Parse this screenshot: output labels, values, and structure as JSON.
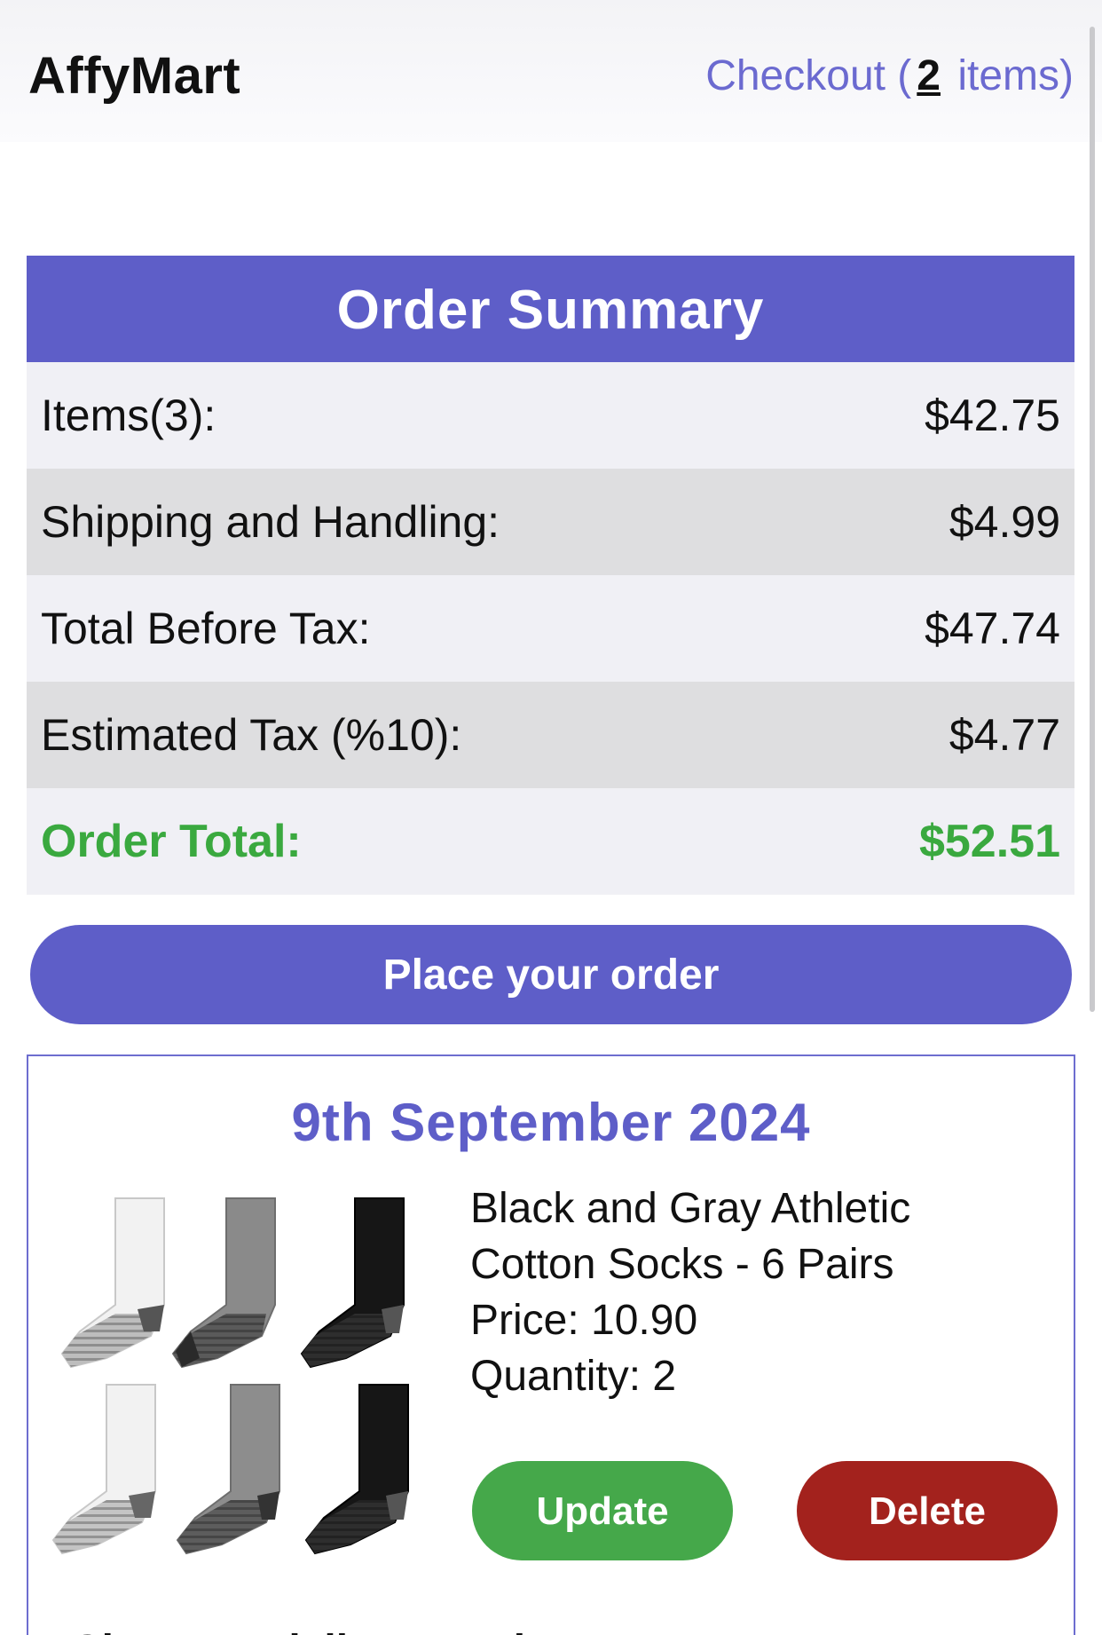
{
  "header": {
    "brand": "AffyMart",
    "checkout_prefix": "Checkout (",
    "checkout_count": "2",
    "checkout_suffix": " items)"
  },
  "summary": {
    "title": "Order Summary",
    "rows": [
      {
        "label": "Items(3):",
        "value": "$42.75"
      },
      {
        "label": "Shipping and Handling:",
        "value": "$4.99"
      },
      {
        "label": "Total Before Tax:",
        "value": "$47.74"
      },
      {
        "label": "Estimated Tax (%10):",
        "value": "$4.77"
      }
    ],
    "total_label": "Order Total:",
    "total_value": "$52.51",
    "place_order_label": "Place your order"
  },
  "order": {
    "date": "9th September 2024",
    "product": {
      "name_line1": "Black and Gray Athletic",
      "name_line2": "Cotton Socks - 6 Pairs",
      "price": "Price: 10.90",
      "quantity": "Quantity: 2",
      "image_icon": "socks-product-image"
    },
    "update_label": "Update",
    "delete_label": "Delete",
    "delivery_label": "Choose a delivery option"
  },
  "colors": {
    "accent": "#5e5ec8",
    "total_green": "#3aa93f",
    "update_green": "#45a84a",
    "delete_red": "#a3221d"
  }
}
